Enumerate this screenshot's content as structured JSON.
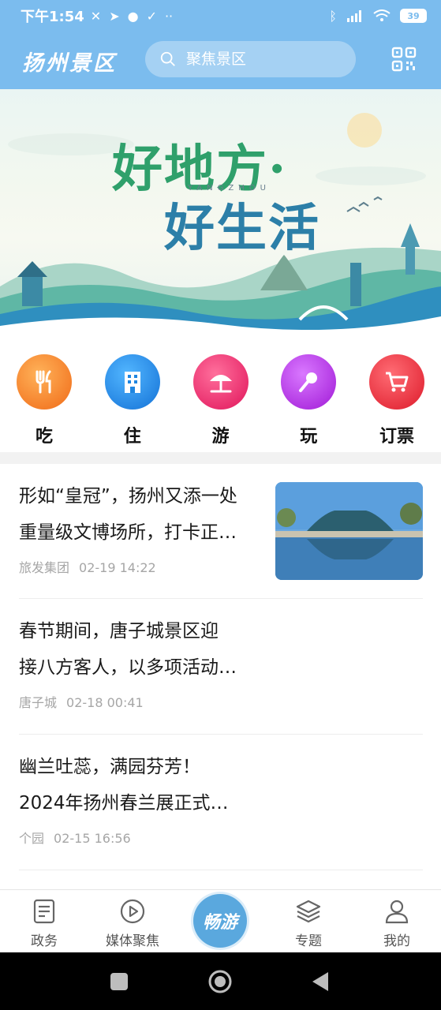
{
  "status": {
    "time": "下午1:54",
    "battery": "39"
  },
  "header": {
    "logo": "扬州景区",
    "search_placeholder": "聚焦景区"
  },
  "banner": {
    "line1": "好地方·",
    "line2": "好生活",
    "sub": "YANGZHOU"
  },
  "categories": [
    {
      "label": "吃",
      "icon": "fork-knife-icon",
      "color": "#f07a22"
    },
    {
      "label": "住",
      "icon": "building-icon",
      "color": "#1f86e0"
    },
    {
      "label": "游",
      "icon": "umbrella-beach-icon",
      "color": "#ec2b6a"
    },
    {
      "label": "玩",
      "icon": "microphone-icon",
      "color": "#b13ae0"
    },
    {
      "label": "订票",
      "icon": "cart-icon",
      "color": "#ea2c3a"
    }
  ],
  "news": [
    {
      "title1": "形如“皇冠”，扬州又添一处",
      "title2": "重量级文博场所，打卡正…",
      "source": "旅发集团",
      "time": "02-19 14:22"
    },
    {
      "title1": "春节期间，唐子城景区迎",
      "title2": "接八方客人，以多项活动…",
      "source": "唐子城",
      "time": "02-18 00:41"
    },
    {
      "title1": "幽兰吐蕊，满园芬芳！",
      "title2": "2024年扬州春兰展正式…",
      "source": "个园",
      "time": "02-15 16:56"
    }
  ],
  "bottom_nav": [
    {
      "label": "政务",
      "icon": "document-icon"
    },
    {
      "label": "媒体聚焦",
      "icon": "play-circle-icon"
    },
    {
      "label": "畅游",
      "icon": "changyou-logo-icon"
    },
    {
      "label": "专题",
      "icon": "layers-icon"
    },
    {
      "label": "我的",
      "icon": "user-icon"
    }
  ]
}
